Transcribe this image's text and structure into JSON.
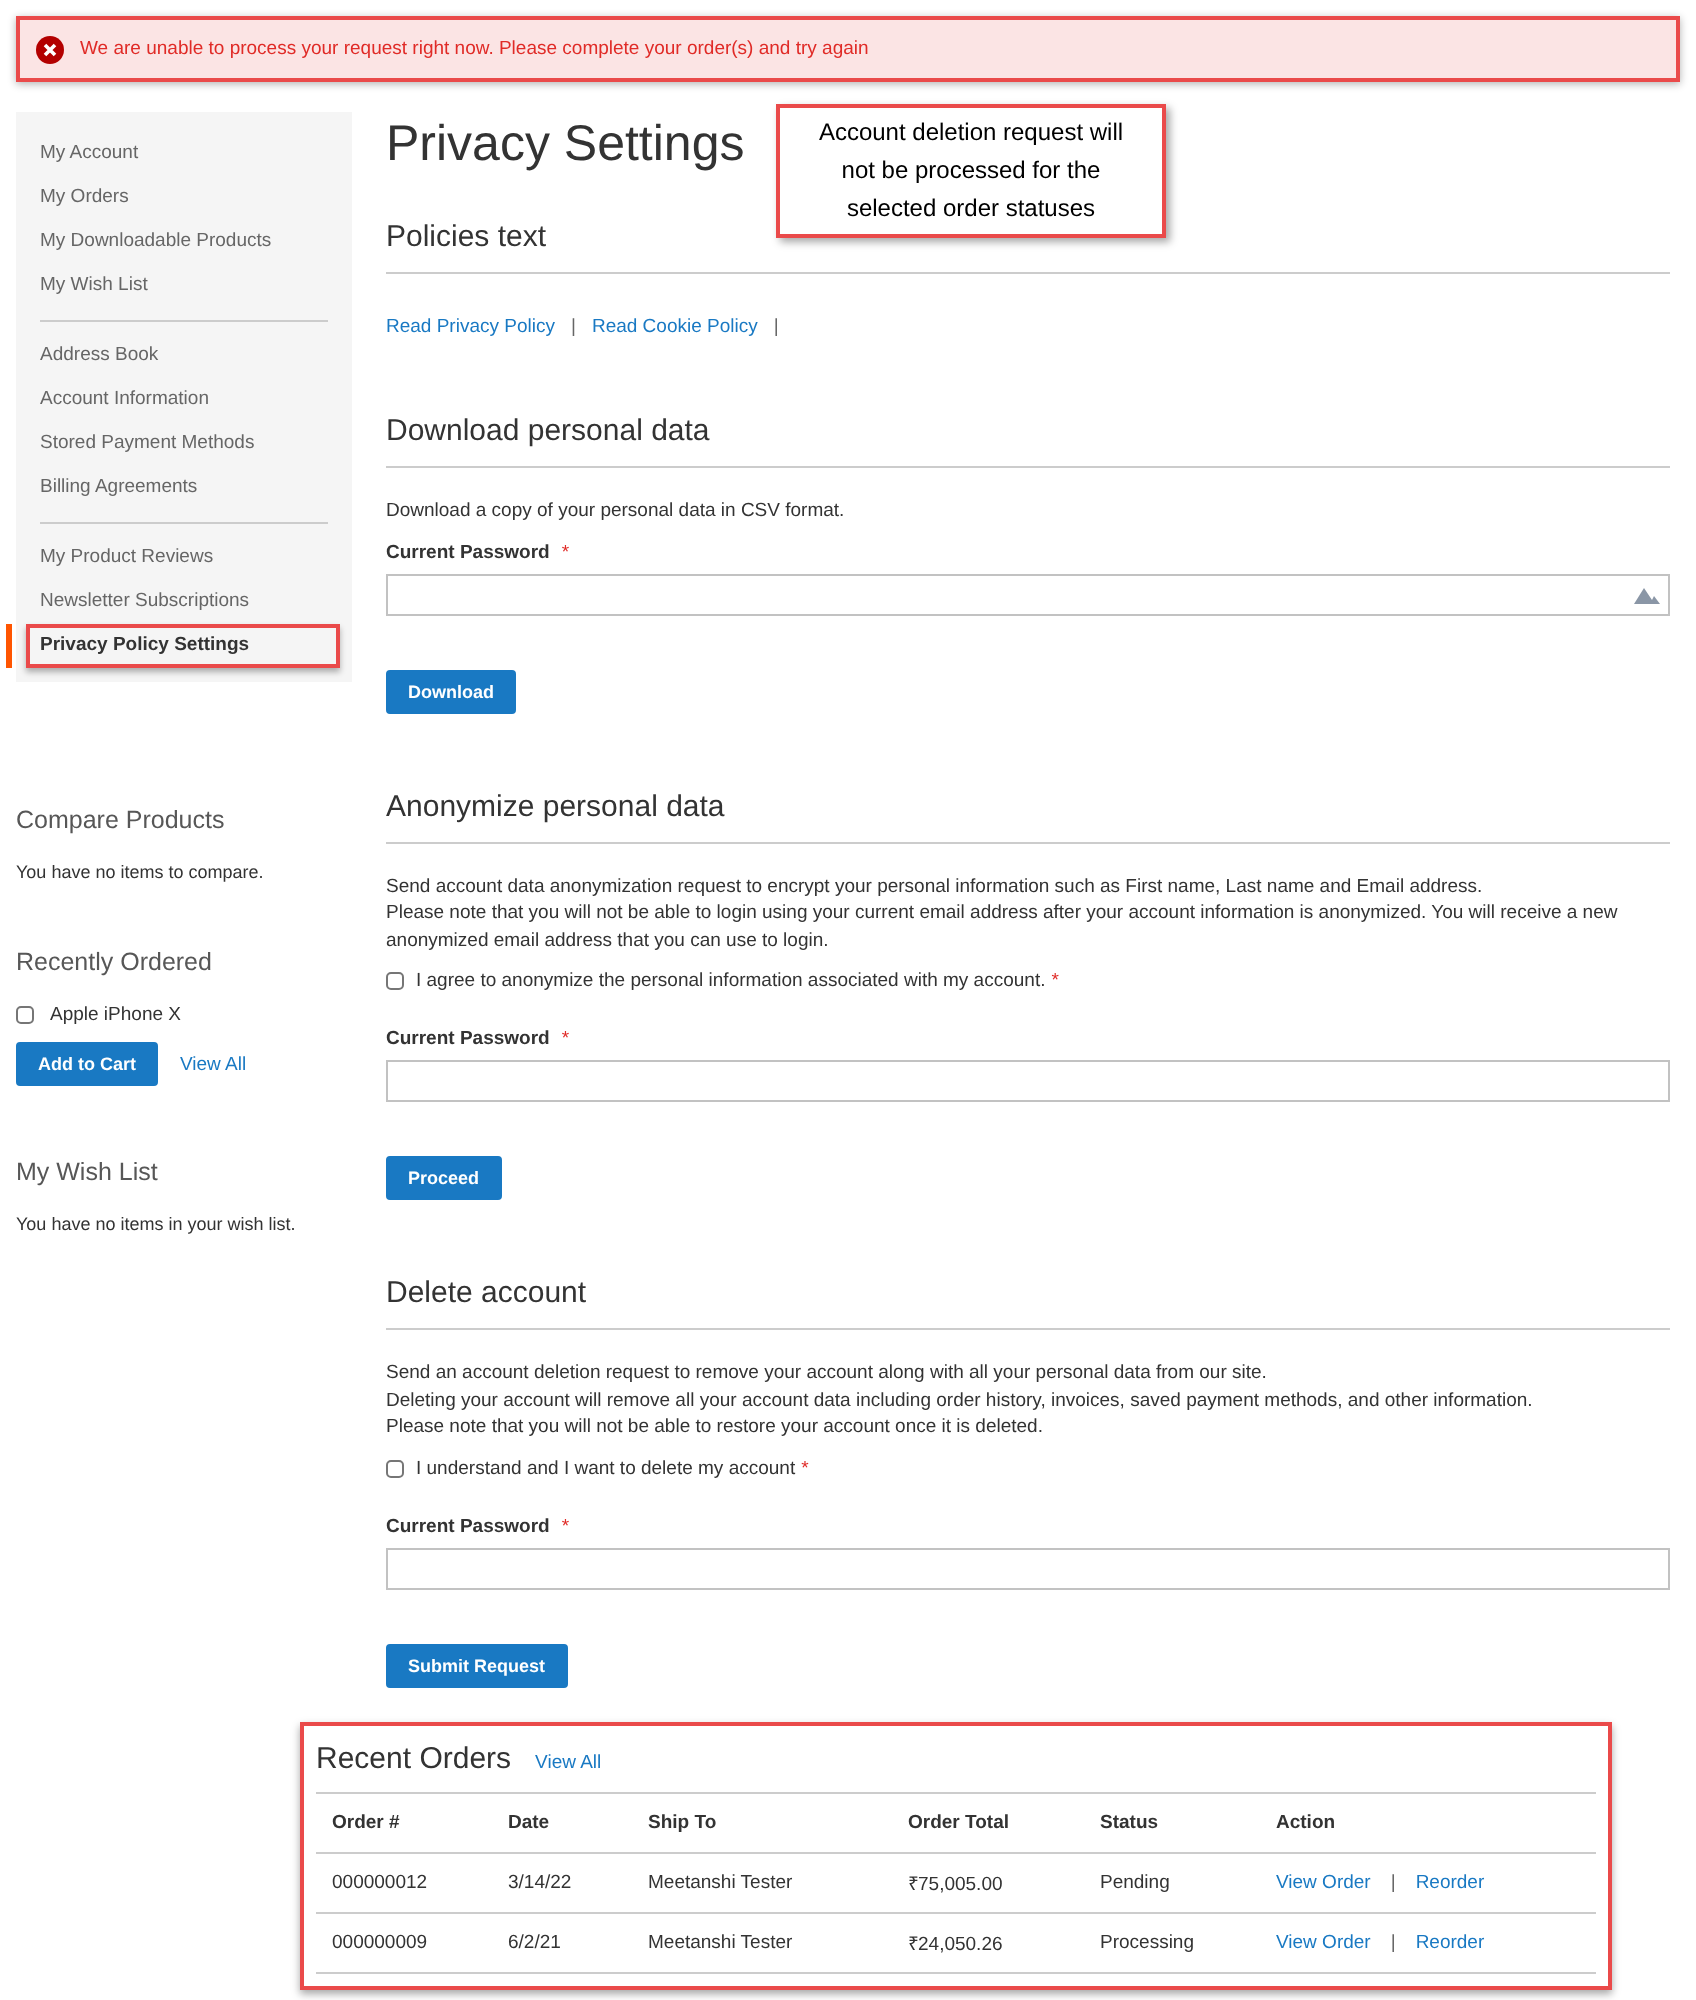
{
  "alert": {
    "text": "We are unable to process your request right now. Please complete your order(s) and try again"
  },
  "sidebar": {
    "groups": [
      {
        "items": [
          {
            "label": "My Account",
            "selected": false
          },
          {
            "label": "My Orders",
            "selected": false
          },
          {
            "label": "My Downloadable Products",
            "selected": false
          },
          {
            "label": "My Wish List",
            "selected": false
          }
        ]
      },
      {
        "items": [
          {
            "label": "Address Book",
            "selected": false
          },
          {
            "label": "Account Information",
            "selected": false
          },
          {
            "label": "Stored Payment Methods",
            "selected": false
          },
          {
            "label": "Billing Agreements",
            "selected": false
          }
        ]
      },
      {
        "items": [
          {
            "label": "My Product Reviews",
            "selected": false
          },
          {
            "label": "Newsletter Subscriptions",
            "selected": false
          },
          {
            "label": "Privacy Policy Settings",
            "selected": true
          }
        ]
      }
    ],
    "compare": {
      "title": "Compare Products",
      "text": "You have no items to compare."
    },
    "recently_ordered": {
      "title": "Recently Ordered",
      "items": [
        {
          "label": "Apple iPhone X",
          "checked": false
        }
      ],
      "button": "Add to Cart",
      "link": "View All"
    },
    "wish_list": {
      "title": "My Wish List",
      "text": "You have no items in your wish list."
    }
  },
  "page_title": "Privacy Settings",
  "callout": "Account deletion request will not be processed for the selected order statuses",
  "sections": [
    {
      "kind": "links",
      "title": "Policies text",
      "links": [
        "Read Privacy Policy",
        "Read Cookie Policy"
      ],
      "separator": "|"
    },
    {
      "kind": "form",
      "title": "Download personal data",
      "paragraphs": [
        "Download a copy of your personal data in CSV format."
      ],
      "field": {
        "label": "Current Password",
        "required_mark": "*",
        "key_icon": true
      },
      "button": "Download"
    },
    {
      "kind": "form",
      "title": "Anonymize personal data",
      "paragraphs": [
        "Send account data anonymization request to encrypt your personal information such as First name, Last name and Email address.",
        "Please note that you will not be able to login using your current email address after your account information is anonymized. You will receive a new anonymized email address that you can use to login."
      ],
      "agree": {
        "label": "I agree to anonymize the personal information associated with my account.",
        "required_mark": "*",
        "checked": false
      },
      "field": {
        "label": "Current Password",
        "required_mark": "*",
        "key_icon": false
      },
      "button": "Proceed"
    },
    {
      "kind": "form",
      "title": "Delete account",
      "paragraphs": [
        "Send an account deletion request to remove your account along with all your personal data from our site.",
        "Deleting your account will remove all your account data including order history, invoices, saved payment methods, and other information.",
        "Please note that you will not be able to restore your account once it is deleted."
      ],
      "agree": {
        "label": "I understand and I want to delete my account",
        "required_mark": "*",
        "checked": false
      },
      "field": {
        "label": "Current Password",
        "required_mark": "*",
        "key_icon": false
      },
      "button": "Submit Request"
    }
  ],
  "recent_orders": {
    "title": "Recent Orders",
    "link": "View All",
    "columns": [
      "Order #",
      "Date",
      "Ship To",
      "Order Total",
      "Status",
      "Action"
    ],
    "separator": "|",
    "rows": [
      {
        "order": "000000012",
        "date": "3/14/22",
        "ship_to": "Meetanshi Tester",
        "total": "₹75,005.00",
        "status": "Pending",
        "actions": [
          "View Order",
          "Reorder"
        ]
      },
      {
        "order": "000000009",
        "date": "6/2/21",
        "ship_to": "Meetanshi Tester",
        "total": "₹24,050.26",
        "status": "Processing",
        "actions": [
          "View Order",
          "Reorder"
        ]
      }
    ]
  }
}
